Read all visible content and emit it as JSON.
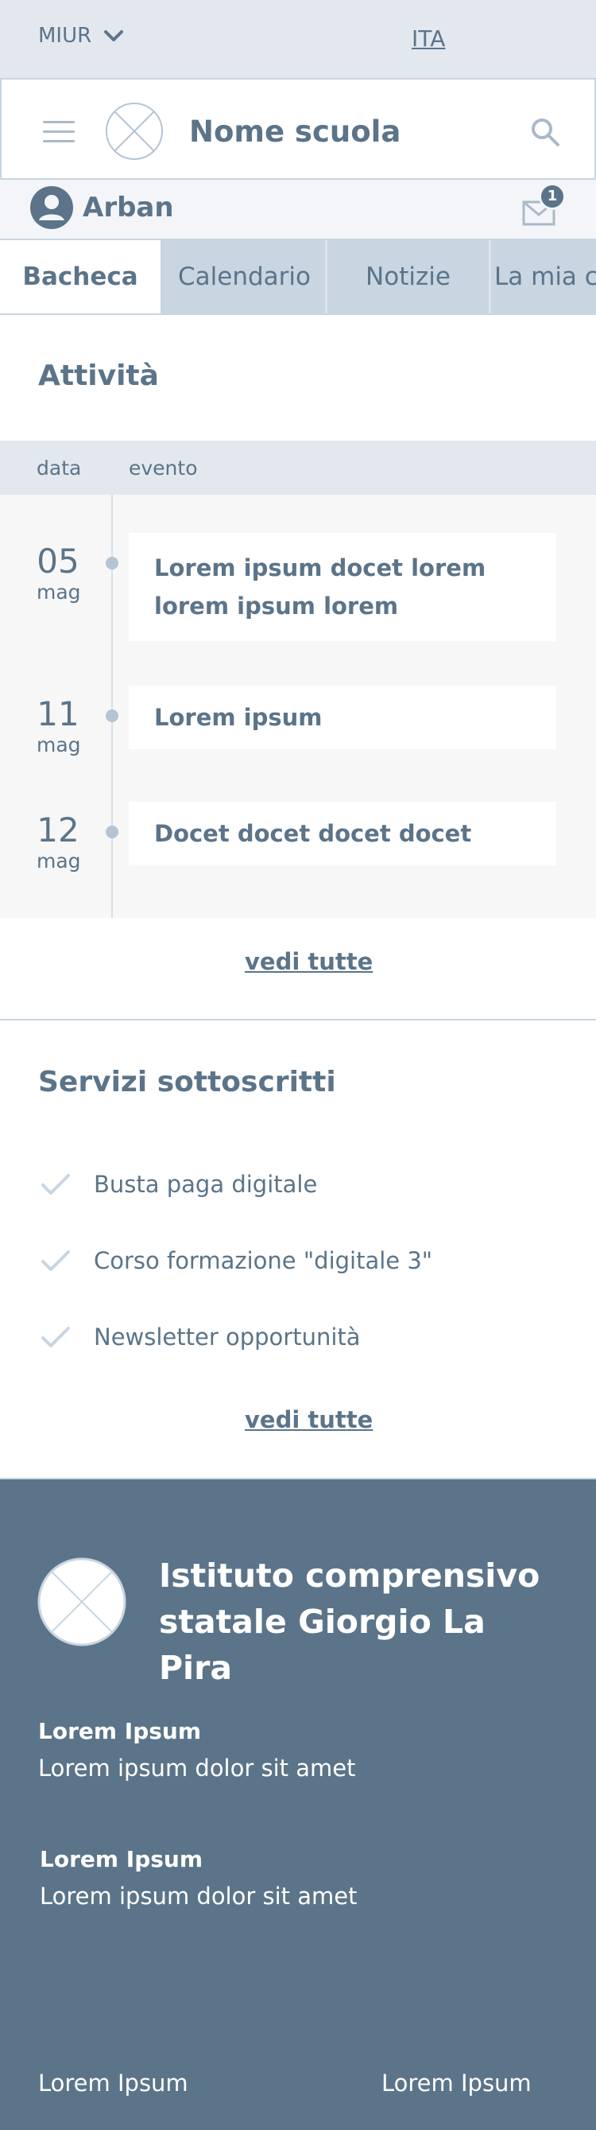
{
  "topbar": {
    "org": "MIUR",
    "language": "ITA"
  },
  "header": {
    "school_name": "Nome scuola"
  },
  "user": {
    "name": "Arban",
    "unread_messages": "1"
  },
  "tabs": [
    {
      "label": "Bacheca",
      "active": true
    },
    {
      "label": "Calendario",
      "active": false
    },
    {
      "label": "Notizie",
      "active": false
    },
    {
      "label": "La mia classe",
      "active": false
    }
  ],
  "activities": {
    "title": "Attività",
    "columns": [
      "data",
      "evento"
    ],
    "events": [
      {
        "day": "05",
        "month": "mag",
        "text": "Lorem ipsum docet lorem lorem ipsum lorem"
      },
      {
        "day": "11",
        "month": "mag",
        "text": "Lorem ipsum"
      },
      {
        "day": "12",
        "month": "mag",
        "text": "Docet docet docet docet"
      }
    ],
    "see_all": "vedi tutte"
  },
  "services": {
    "title": "Servizi sottoscritti",
    "items": [
      "Busta paga digitale",
      "Corso formazione \"digitale 3\"",
      "Newsletter opportunità"
    ],
    "see_all": "vedi tutte"
  },
  "footer": {
    "institute": "Istituto comprensivo statale Giorgio La Pira",
    "blocks": [
      {
        "label": "Lorem Ipsum",
        "text": "Lorem ipsum dolor sit amet"
      },
      {
        "label": "Lorem Ipsum",
        "text": "Lorem ipsum dolor sit amet"
      }
    ],
    "links": [
      "Lorem Ipsum",
      "Lorem Ipsum"
    ]
  },
  "colors": {
    "primary": "#5b7489",
    "light_bg": "#e3e8ef",
    "tab_bg": "#c9d5e1",
    "footer_bg": "#5b7489"
  }
}
